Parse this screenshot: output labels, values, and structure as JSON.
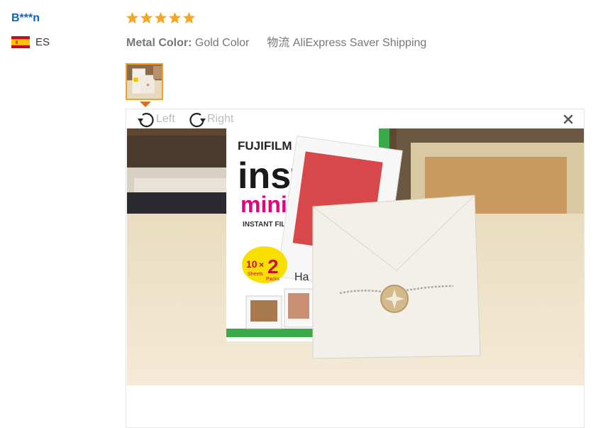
{
  "reviewer": {
    "name": "B***n",
    "country": "ES"
  },
  "rating": {
    "stars": 5,
    "max": 5,
    "color": "#f5a623"
  },
  "attributes": {
    "metal_label": "Metal Color:",
    "metal_value": "Gold Color",
    "shipping_label": "物流",
    "shipping_value": "AliExpress Saver Shipping"
  },
  "viewer": {
    "rotate_left": "Left",
    "rotate_right": "Right",
    "photo": {
      "brand": "FUJIFILM",
      "product": "instax",
      "product_sub": "mini",
      "film_label": "INSTANT FILM",
      "pack_count": "10",
      "pack_x": "×",
      "pack_two": "2",
      "pack_sheets": "Sheets",
      "pack_packs": "Packs",
      "card_text": "Ha"
    }
  },
  "colors": {
    "link": "#0066cc",
    "accent": "#e86a10",
    "thumb_border": "#f0a030"
  }
}
